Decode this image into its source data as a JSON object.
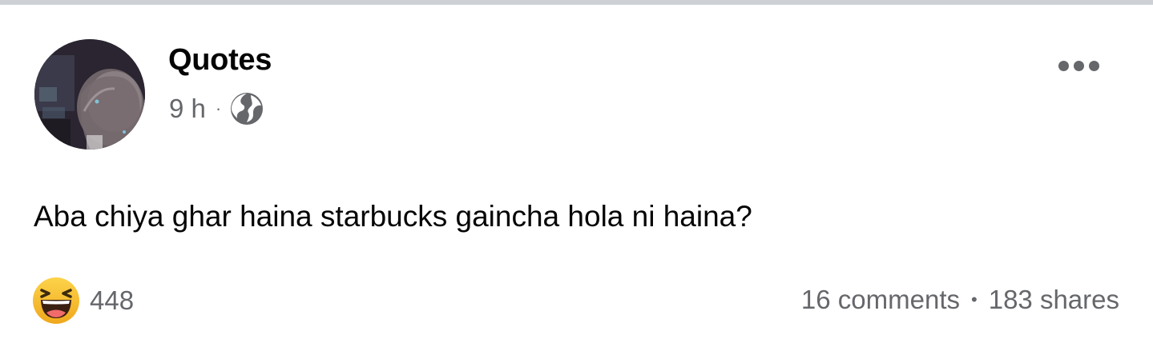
{
  "post": {
    "page_name": "Quotes",
    "time": "9 h",
    "separator": "·",
    "audience_icon": "globe-icon",
    "more_icon": "more-options-icon",
    "text": "Aba chiya ghar haina starbucks gaincha hola ni haina?",
    "reaction_icon": "haha-emoji-icon",
    "reaction_count": "448",
    "comments": "16 comments",
    "engagement_separator": "•",
    "shares": "183 shares"
  },
  "colors": {
    "text_primary": "#050505",
    "text_secondary": "#65676b",
    "divider": "#cdd0d4",
    "reaction_yellow": "#f7b125"
  }
}
